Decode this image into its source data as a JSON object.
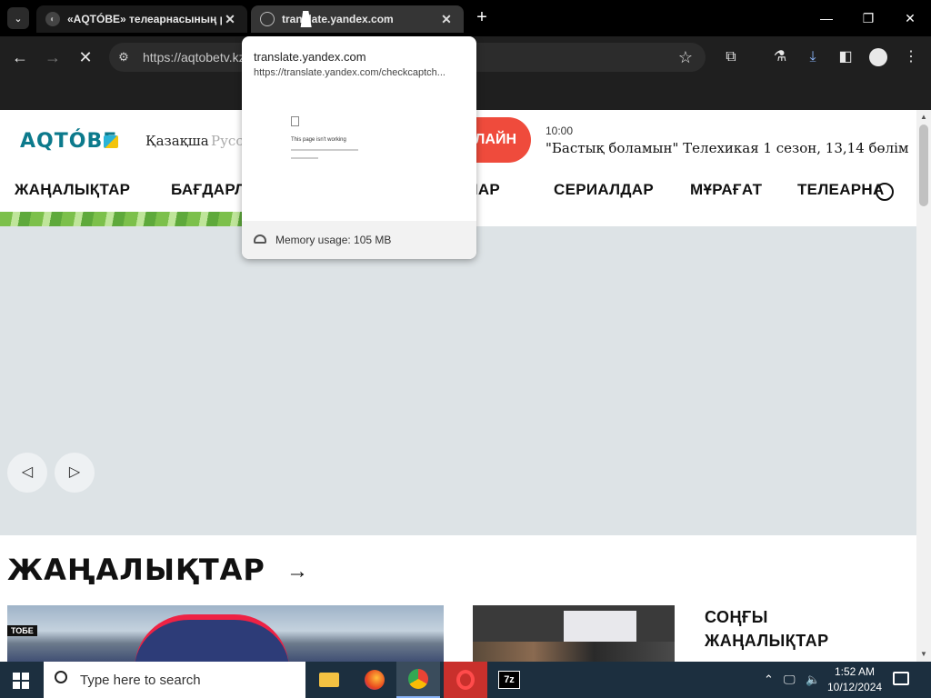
{
  "browser": {
    "tabs": [
      {
        "title": "«AQTÓBE» телеарнасының ресми сайты"
      },
      {
        "title": "translate.yandex.com"
      }
    ],
    "url": "https://aqtobetv.kz"
  },
  "hover_card": {
    "title": "translate.yandex.com",
    "url": "https://translate.yandex.com/checkcaptch...",
    "preview_text": "This page isn't working",
    "memory": "Memory usage: 105 MB"
  },
  "site": {
    "logo": "AQTÓBE",
    "lang_kz": "Қазақша",
    "lang_ru": "Русский",
    "live_button": "ОНЛАЙН",
    "now_playing_time": "10:00",
    "now_playing_title": "\"Бастық боламын\" Телехикая 1 сезон, 13,14 бөлім",
    "nav": [
      "ЖАҢАЛЫҚТАР",
      "БАҒДАРЛАМАЛАР",
      "ЖОБАЛАР",
      "СЕРИАЛДАР",
      "МҰРАҒАТ",
      "ТЕЛЕАРНА"
    ],
    "news_heading": "ЖАҢАЛЫҚТАР",
    "news_img_label": "ТОБЕ",
    "latest_news": [
      "СОҢҒЫ",
      "ЖАҢАЛЫҚТАР"
    ]
  },
  "taskbar": {
    "search_placeholder": "Type here to search",
    "time": "1:52 AM",
    "date": "10/12/2024"
  }
}
